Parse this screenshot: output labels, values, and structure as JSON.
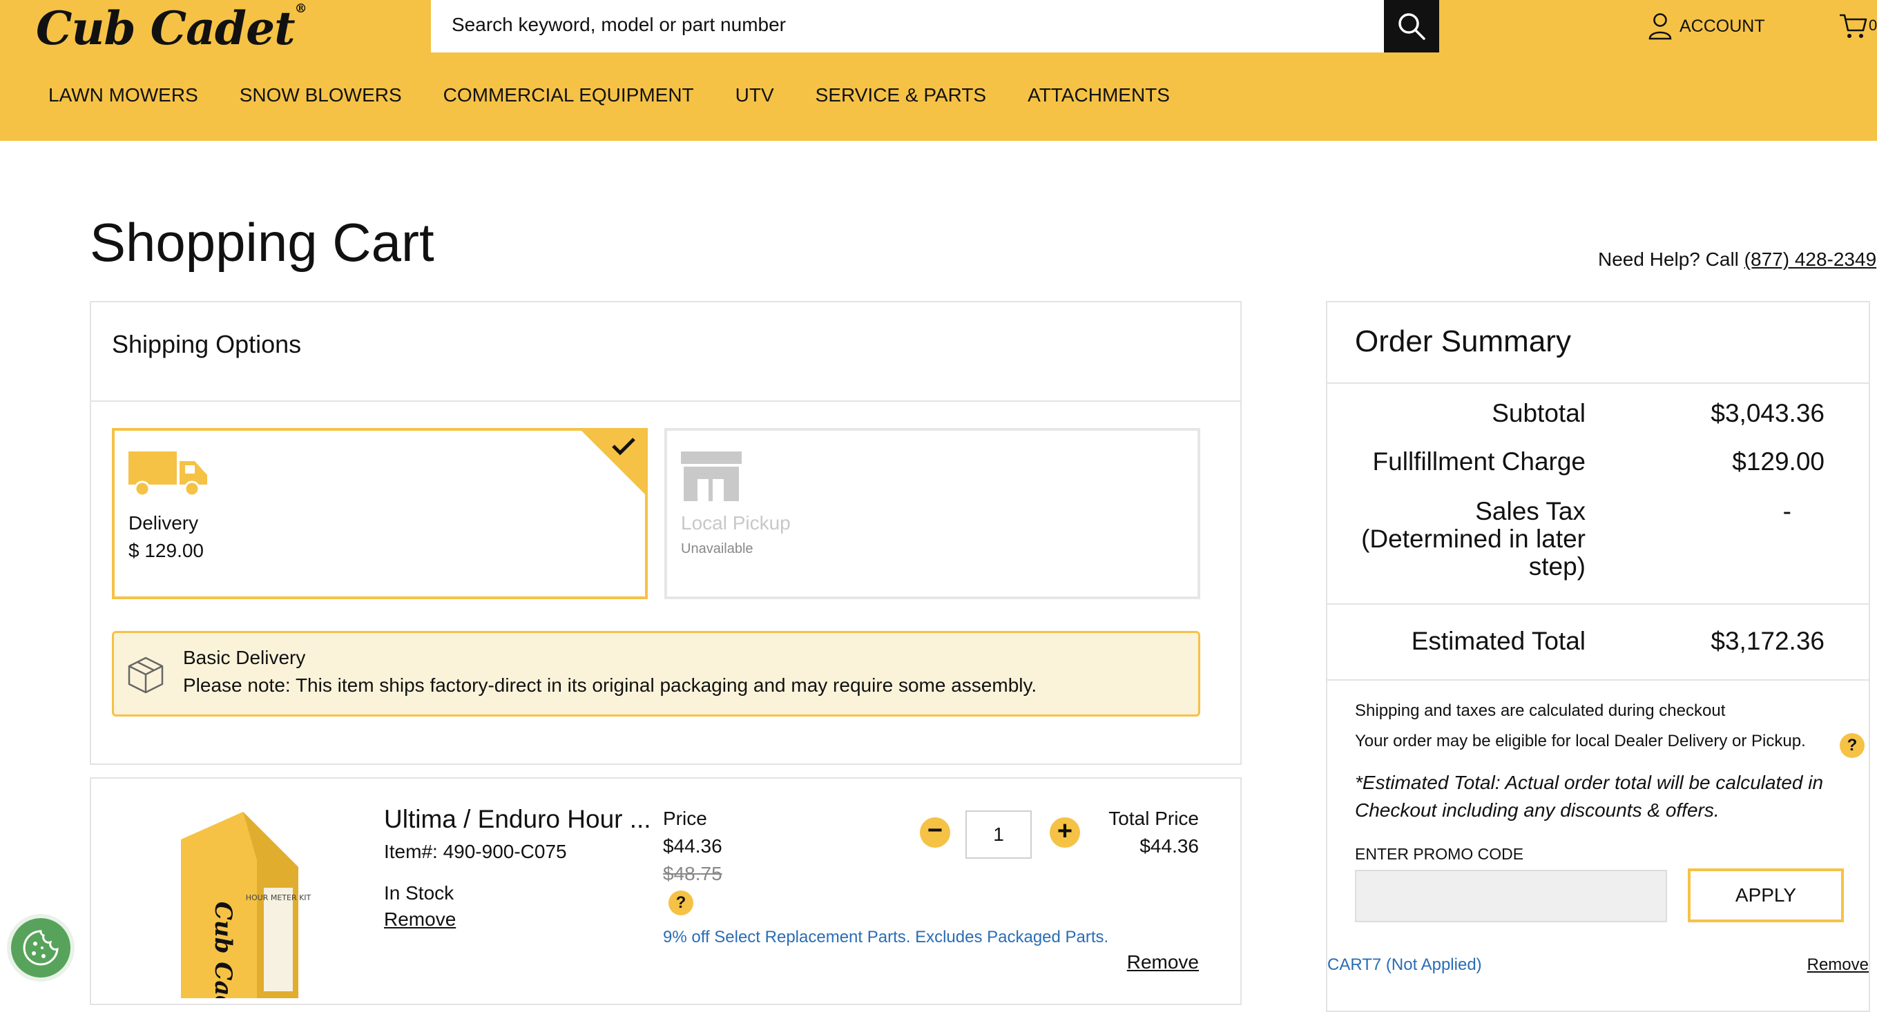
{
  "header": {
    "logo": "Cub Cadet",
    "search_placeholder": "Search keyword, model or part number",
    "account_label": "ACCOUNT",
    "cart_count": "0",
    "nav": [
      "LAWN MOWERS",
      "SNOW BLOWERS",
      "COMMERCIAL EQUIPMENT",
      "UTV",
      "SERVICE & PARTS",
      "ATTACHMENTS"
    ]
  },
  "page": {
    "title": "Shopping Cart",
    "help_prefix": "Need Help? Call",
    "help_phone": "(877) 428-2349"
  },
  "shipping": {
    "title": "Shipping Options",
    "options": [
      {
        "name": "Delivery",
        "price": "$ 129.00",
        "selected": true
      },
      {
        "name": "Local Pickup",
        "status": "Unavailable",
        "selected": false
      }
    ],
    "note_title": "Basic Delivery",
    "note_text": "Please note: This item ships factory-direct in its original packaging and may require some assembly."
  },
  "item": {
    "name": "Ultima / Enduro Hour ...",
    "item_number": "Item#: 490-900-C075",
    "stock": "In Stock",
    "remove_label": "Remove",
    "price_label": "Price",
    "price": "$44.36",
    "original_price": "$48.75",
    "discount_text": "9% off Select Replacement Parts. Excludes Packaged Parts.",
    "quantity": "1",
    "total_label": "Total Price",
    "total": "$44.36",
    "remove_label_2": "Remove",
    "image_text": "Cub Cadet",
    "image_label": "HOUR METER KIT"
  },
  "summary": {
    "title": "Order Summary",
    "subtotal_label": "Subtotal",
    "subtotal": "$3,043.36",
    "fulfillment_label": "Fullfillment Charge",
    "fulfillment": "$129.00",
    "tax_label_1": "Sales Tax",
    "tax_label_2": "(Determined in later",
    "tax_label_3": "step)",
    "tax": "-",
    "total_label": "Estimated Total",
    "total": "$3,172.36",
    "info_1": "Shipping and taxes are calculated during checkout",
    "info_2": "Your order may be eligible for local Dealer Delivery or Pickup.",
    "disclaimer": "*Estimated Total: Actual order total will be calculated in Checkout including any discounts & offers.",
    "promo_label": "ENTER PROMO CODE",
    "apply_label": "APPLY",
    "promo_code": "CART7 (Not Applied)",
    "promo_remove": "Remove"
  },
  "colors": {
    "brand_yellow": "#f5c246",
    "note_bg": "#fbf3d9",
    "link_blue": "#2a6db4"
  },
  "icons": [
    "search-icon",
    "account-icon",
    "cart-icon",
    "truck-icon",
    "store-icon",
    "checkmark-icon",
    "box-icon",
    "question-icon",
    "minus-icon",
    "plus-icon",
    "cookie-icon"
  ]
}
